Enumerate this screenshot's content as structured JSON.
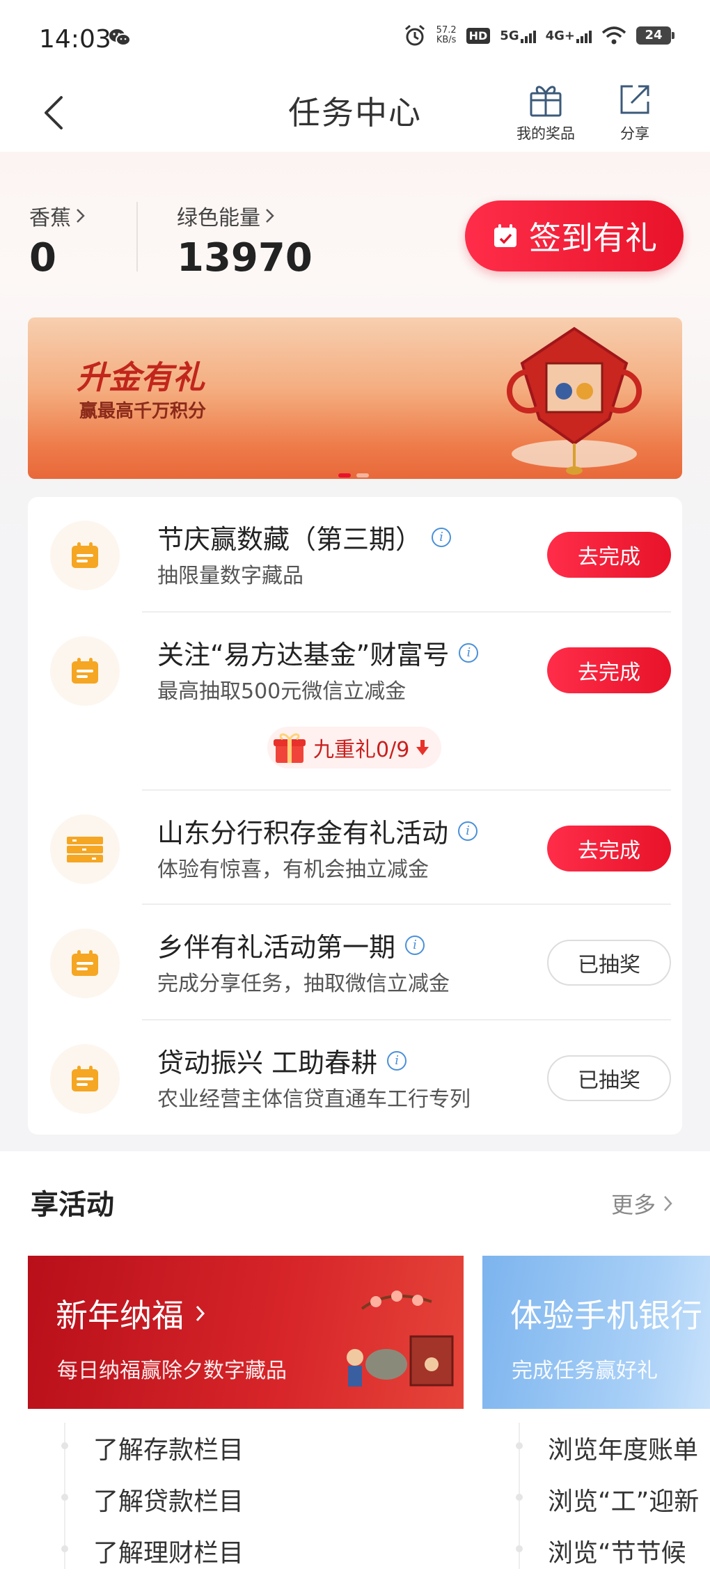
{
  "status_bar": {
    "time": "14:03",
    "net_speed_value": "57.2",
    "net_speed_unit": "KB/s",
    "hd_label": "HD",
    "sim1_net": "5G",
    "sim2_net": "4G+",
    "battery": "24"
  },
  "nav": {
    "title": "任务中心",
    "gift_label": "我的奖品",
    "share_label": "分享"
  },
  "stats": {
    "banana_label": "香蕉",
    "banana_value": "0",
    "energy_label": "绿色能量",
    "energy_value": "13970",
    "signin_label": "签到有礼"
  },
  "banner": {
    "title": "升金有礼",
    "subtitle": "赢最高千万积分",
    "active_index": 0,
    "dot_count": 2
  },
  "tasks": [
    {
      "title": "节庆赢数藏（第三期）",
      "desc": "抽限量数字藏品",
      "button": "去完成",
      "state": "todo",
      "icon": "calendar-icon"
    },
    {
      "title": "关注“易方达基金”财富号",
      "desc": "最高抽取500元微信立减金",
      "button": "去完成",
      "state": "todo",
      "icon": "calendar-icon"
    },
    {
      "title": "山东分行积存金有礼活动",
      "desc": "体验有惊喜，有机会抽立减金",
      "button": "去完成",
      "state": "todo",
      "icon": "gold-bars-icon"
    },
    {
      "title": "乡伴有礼活动第一期",
      "desc": "完成分享任务，抽取微信立减金",
      "button": "已抽奖",
      "state": "done",
      "icon": "calendar-icon"
    },
    {
      "title": "贷动振兴 工助春耕",
      "desc": "农业经营主体信贷直通车工行专列",
      "button": "已抽奖",
      "state": "done",
      "icon": "calendar-icon"
    }
  ],
  "gift_pill": {
    "label": "九重礼0/9"
  },
  "activities": {
    "section_title": "享活动",
    "more_label": "更多",
    "cards": [
      {
        "title": "新年纳福",
        "subtitle": "每日纳福赢除夕数字藏品",
        "items": [
          "了解存款栏目",
          "了解贷款栏目",
          "了解理财栏目"
        ]
      },
      {
        "title": "体验手机银行",
        "subtitle": "完成任务赢好礼",
        "items": [
          "浏览年度账单",
          "浏览“工”迎新",
          "浏览“节节候"
        ]
      }
    ]
  },
  "colors": {
    "brand_red": "#e8132a",
    "accent_orange": "#f5a623",
    "info_blue": "#4a90d9"
  }
}
